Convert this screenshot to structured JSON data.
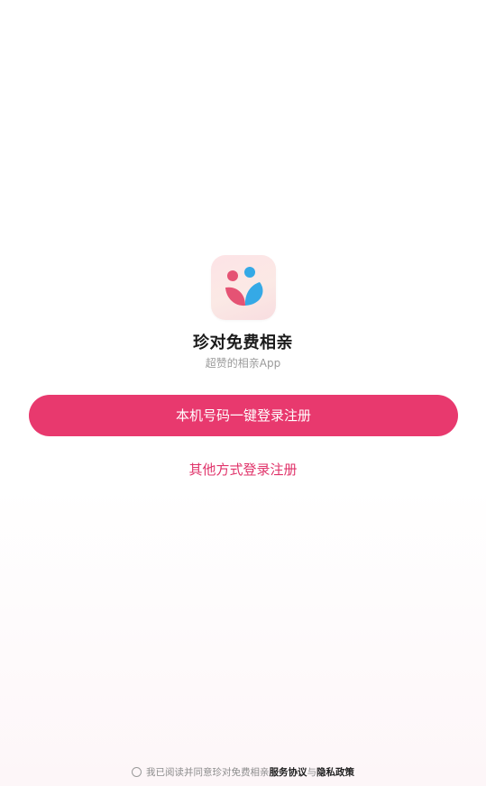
{
  "app": {
    "logo_icon": "two-people-leaf-logo-icon",
    "name": "珍对免费相亲",
    "slogan": "超赞的相亲App"
  },
  "actions": {
    "one_click_login_label": "本机号码一键登录注册",
    "other_login_label": "其他方式登录注册"
  },
  "agreement": {
    "checked": false,
    "prefix": "我已阅读并同意珍对免费相亲",
    "service_terms": "服务协议",
    "conjunction": "与",
    "privacy_policy": "隐私政策"
  },
  "colors": {
    "primary": "#e8396e",
    "link": "#e0336a",
    "logo_pink": "#e55374",
    "logo_blue": "#35a9e6"
  }
}
